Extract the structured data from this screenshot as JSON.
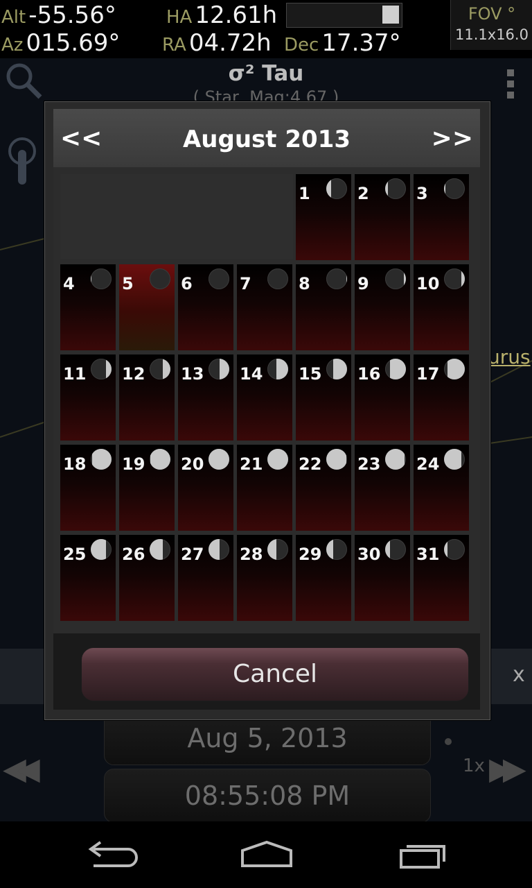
{
  "hud": {
    "alt_label": "Alt",
    "alt_value": "-55.56°",
    "az_label": "Az",
    "az_value": "015.69°",
    "ha_label": "HA",
    "ha_value": "12.61h",
    "ra_label": "RA",
    "ra_value": "04.72h",
    "dec_label": "Dec",
    "dec_value": "17.37°",
    "fov_label": "FOV °",
    "fov_value": "11.1x16.0"
  },
  "object": {
    "name": "σ² Tau",
    "subtitle": "( Star, Mag:4.67 )"
  },
  "map_label": "urus",
  "controls": {
    "date": "Aug 5, 2013",
    "time": "08:55:08 PM",
    "speed": "1x",
    "close": "x"
  },
  "calendar": {
    "title": "August 2013",
    "prev_label": "<<",
    "next_label": ">>",
    "selected_day": 5,
    "days": [
      {
        "d": "1",
        "phase": 0.22,
        "waxing": false
      },
      {
        "d": "2",
        "phase": 0.14,
        "waxing": false
      },
      {
        "d": "3",
        "phase": 0.07,
        "waxing": false
      },
      {
        "d": "4",
        "phase": 0.03,
        "waxing": false
      },
      {
        "d": "5",
        "phase": 0.01,
        "waxing": false
      },
      {
        "d": "6",
        "phase": 0.0,
        "waxing": true
      },
      {
        "d": "7",
        "phase": 0.01,
        "waxing": true
      },
      {
        "d": "8",
        "phase": 0.04,
        "waxing": true
      },
      {
        "d": "9",
        "phase": 0.09,
        "waxing": true
      },
      {
        "d": "10",
        "phase": 0.16,
        "waxing": true
      },
      {
        "d": "11",
        "phase": 0.25,
        "waxing": true
      },
      {
        "d": "12",
        "phase": 0.35,
        "waxing": true
      },
      {
        "d": "13",
        "phase": 0.45,
        "waxing": true
      },
      {
        "d": "14",
        "phase": 0.55,
        "waxing": true
      },
      {
        "d": "15",
        "phase": 0.65,
        "waxing": true
      },
      {
        "d": "16",
        "phase": 0.75,
        "waxing": true
      },
      {
        "d": "17",
        "phase": 0.84,
        "waxing": true
      },
      {
        "d": "18",
        "phase": 0.92,
        "waxing": true
      },
      {
        "d": "19",
        "phase": 0.97,
        "waxing": true
      },
      {
        "d": "20",
        "phase": 1.0,
        "waxing": true
      },
      {
        "d": "21",
        "phase": 1.0,
        "waxing": false
      },
      {
        "d": "22",
        "phase": 0.97,
        "waxing": false
      },
      {
        "d": "23",
        "phase": 0.92,
        "waxing": false
      },
      {
        "d": "24",
        "phase": 0.82,
        "waxing": false
      },
      {
        "d": "25",
        "phase": 0.72,
        "waxing": false
      },
      {
        "d": "26",
        "phase": 0.62,
        "waxing": false
      },
      {
        "d": "27",
        "phase": 0.52,
        "waxing": false
      },
      {
        "d": "28",
        "phase": 0.42,
        "waxing": false
      },
      {
        "d": "29",
        "phase": 0.32,
        "waxing": false
      },
      {
        "d": "30",
        "phase": 0.23,
        "waxing": false
      },
      {
        "d": "31",
        "phase": 0.15,
        "waxing": false
      }
    ],
    "cancel_label": "Cancel"
  }
}
